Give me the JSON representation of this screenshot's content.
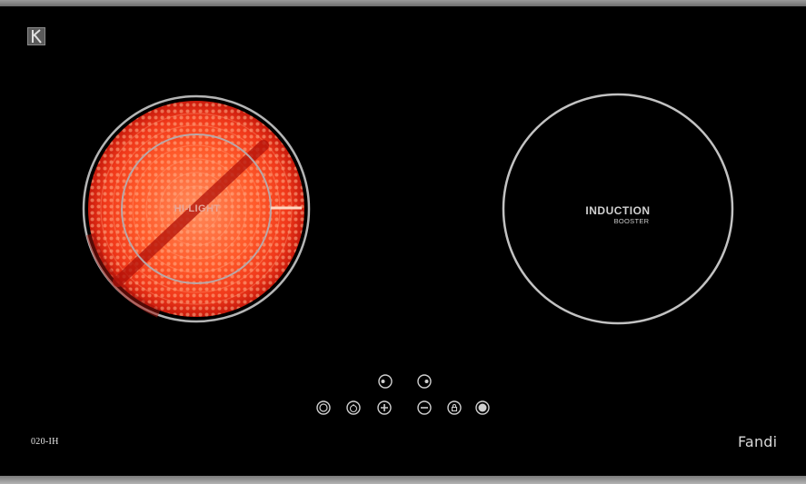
{
  "model": "020-IH",
  "brand": "Fandi",
  "zones": {
    "left": {
      "label": "HI-LIGHT"
    },
    "right": {
      "label": "INDUCTION",
      "sublabel": "BOOSTER"
    }
  },
  "controls": {
    "row1": [
      {
        "name": "left-zone-select",
        "icon": "zone-left-icon"
      },
      {
        "name": "right-zone-select",
        "icon": "zone-right-icon"
      }
    ],
    "row2": [
      {
        "name": "power",
        "icon": "power-icon"
      },
      {
        "name": "timer",
        "icon": "timer-icon"
      },
      {
        "name": "plus",
        "icon": "plus-icon"
      },
      {
        "name": "minus",
        "icon": "minus-icon"
      },
      {
        "name": "lock",
        "icon": "lock-icon"
      },
      {
        "name": "boost",
        "icon": "boost-icon"
      }
    ]
  },
  "colors": {
    "glass": "#000000",
    "heat": "#ff3b14",
    "ring": "#b8b8b8"
  }
}
